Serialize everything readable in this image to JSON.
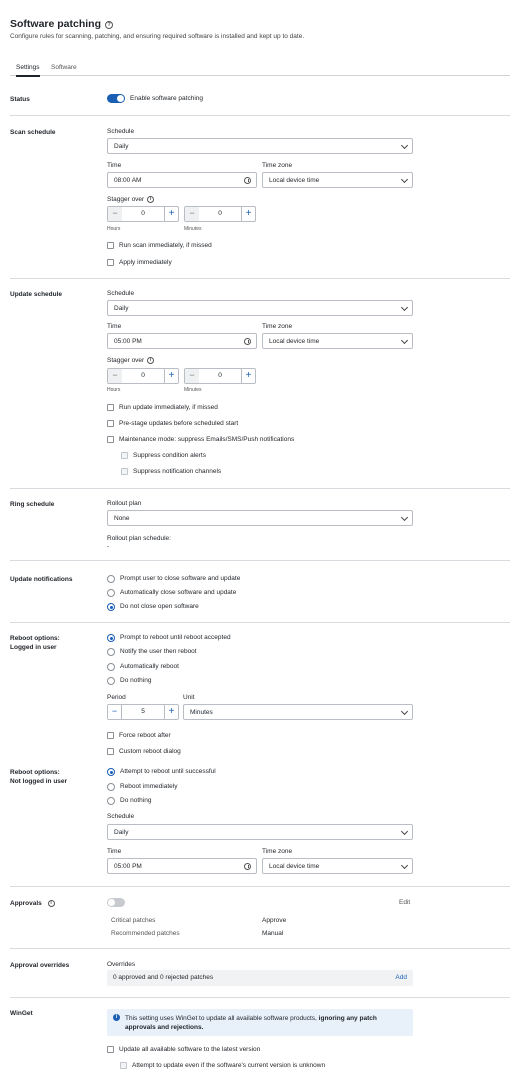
{
  "header": {
    "title": "Software patching",
    "subtitle": "Configure rules for scanning, patching, and ensuring required software is installed and kept up to date."
  },
  "tabs": [
    "Settings",
    "Software"
  ],
  "status": {
    "label": "Status",
    "toggle_label": "Enable software patching",
    "enabled": true
  },
  "scan": {
    "label": "Scan schedule",
    "schedule_label": "Schedule",
    "schedule_value": "Daily",
    "time_label": "Time",
    "time_value": "08:00 AM",
    "tz_label": "Time zone",
    "tz_value": "Local device time",
    "stagger_label": "Stagger over",
    "hours_value": "0",
    "hours_caption": "Hours",
    "minutes_value": "0",
    "minutes_caption": "Minutes",
    "options": [
      "Run scan immediately, if missed",
      "Apply immediately"
    ]
  },
  "update": {
    "label": "Update schedule",
    "schedule_label": "Schedule",
    "schedule_value": "Daily",
    "time_label": "Time",
    "time_value": "05:00 PM",
    "tz_label": "Time zone",
    "tz_value": "Local device time",
    "stagger_label": "Stagger over",
    "hours_value": "0",
    "hours_caption": "Hours",
    "minutes_value": "0",
    "minutes_caption": "Minutes",
    "options": [
      "Run update immediately, if missed",
      "Pre-stage updates before scheduled start",
      "Maintenance mode: suppress Emails/SMS/Push notifications"
    ],
    "sub_options": [
      "Suppress condition alerts",
      "Suppress notification channels"
    ]
  },
  "ring": {
    "label": "Ring schedule",
    "rollout_label": "Rollout plan",
    "rollout_value": "None",
    "rollout_schedule_label": "Rollout plan schedule:",
    "rollout_schedule_value": "-"
  },
  "notifications": {
    "label": "Update notifications",
    "options": [
      "Prompt user to close software and update",
      "Automatically close software and update",
      "Do not close open software"
    ],
    "selected": 2
  },
  "reboot_logged": {
    "label_line1": "Reboot options:",
    "label_line2": "Logged in user",
    "options": [
      "Prompt to reboot until reboot accepted",
      "Notify the user then reboot",
      "Automatically reboot",
      "Do nothing"
    ],
    "selected": 0,
    "period_label": "Period",
    "period_value": "5",
    "unit_label": "Unit",
    "unit_value": "Minutes",
    "checks": [
      "Force reboot after",
      "Custom reboot dialog"
    ]
  },
  "reboot_not_logged": {
    "label_line1": "Reboot options:",
    "label_line2": "Not logged in user",
    "options": [
      "Attempt to reboot until successful",
      "Reboot immediately",
      "Do nothing"
    ],
    "selected": 0,
    "schedule_label": "Schedule",
    "schedule_value": "Daily",
    "time_label": "Time",
    "time_value": "05:00 PM",
    "tz_label": "Time zone",
    "tz_value": "Local device time"
  },
  "approvals": {
    "label": "Approvals",
    "edit": "Edit",
    "enabled": false,
    "rows": [
      {
        "name": "Critical patches",
        "value": "Approve"
      },
      {
        "name": "Recommended patches",
        "value": "Manual"
      }
    ]
  },
  "overrides": {
    "label": "Approval overrides",
    "field_label": "Overrides",
    "value": "0 approved and 0 rejected patches",
    "add": "Add"
  },
  "winget": {
    "label": "WinGet",
    "info_text": "This setting uses WinGet to update all available software products,",
    "info_bold": "ignoring any patch approvals and rejections.",
    "options": [
      "Update all available software to the latest version"
    ],
    "sub_options": [
      "Attempt to update even if the software's current version is unknown"
    ]
  },
  "colors": {
    "accent": "#1a5fb4",
    "info_bg": "#e8f0fa"
  }
}
